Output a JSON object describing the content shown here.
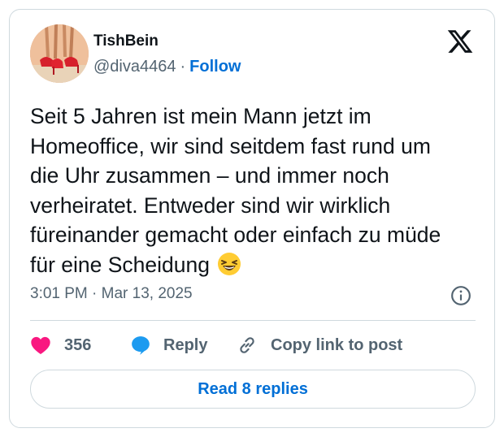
{
  "user": {
    "name": "TishBein",
    "handle": "@diva4464",
    "separator": "·",
    "follow_label": "Follow"
  },
  "tweet": {
    "text": "Seit 5 Jahren ist mein Mann jetzt im Homeoffice, wir sind seitdem fast rund um die Uhr zusammen – und immer noch verheiratet. Entweder sind wir wirklich füreinander gemacht oder einfach zu müde für eine Scheidung",
    "emoji": "grinning-squinting-face-emoji",
    "timestamp": "3:01 PM · Mar 13, 2025"
  },
  "actions": {
    "like_count": "356",
    "reply_label": "Reply",
    "copy_label": "Copy link to post"
  },
  "read_replies_label": "Read 8 replies",
  "icons": {
    "brand": "x-logo-icon",
    "info": "info-icon",
    "like": "heart-icon",
    "reply": "speech-bubble-icon",
    "copy": "link-icon"
  },
  "colors": {
    "text": "#0f1419",
    "secondary": "#536471",
    "link": "#006fd6",
    "like": "#f91880",
    "reply": "#1d9bf0",
    "border": "#cfd9de"
  }
}
